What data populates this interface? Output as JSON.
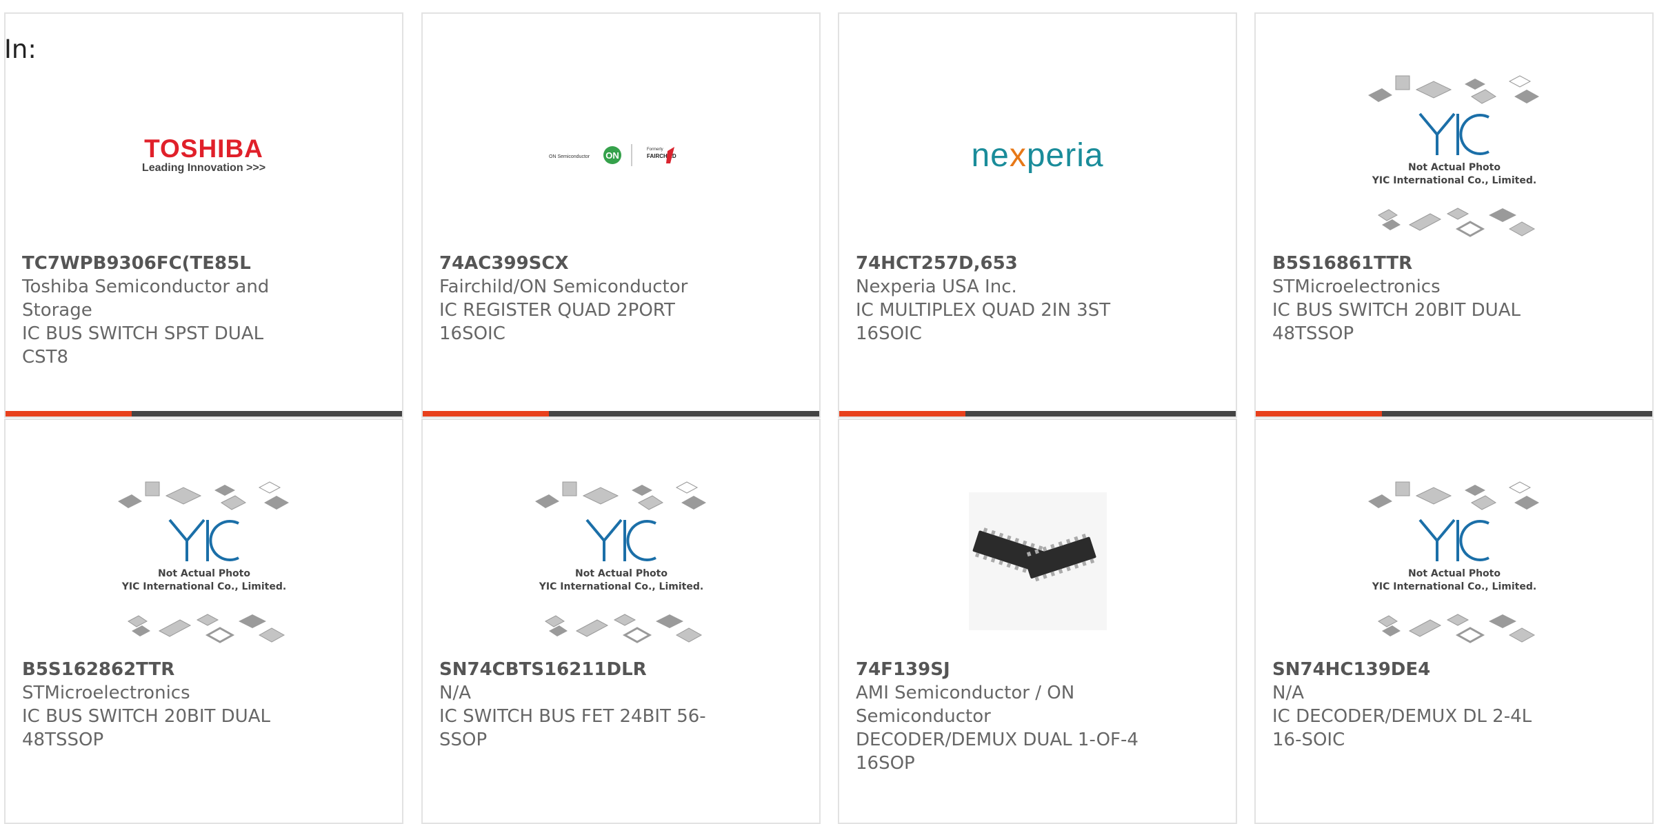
{
  "header": {
    "label": "In:"
  },
  "brand_colors": {
    "accent": "#e8401c",
    "bar": "#444444",
    "toshiba_red": "#e0202a",
    "nexperia_teal": "#1a8c9a",
    "yic_blue": "#1b6fa8"
  },
  "placeholder": {
    "line1": "Not Actual Photo",
    "line2": "YIC International Co., Limited."
  },
  "logos": {
    "toshiba": {
      "brand": "TOSHIBA",
      "tagline": "Leading Innovation >>>"
    },
    "onsemi": {
      "left": "ON Semiconductor",
      "formerly": "Formerly",
      "right": "FAIRCHILD"
    },
    "nexperia": {
      "before": "ne",
      "x": "x",
      "after": "peria"
    }
  },
  "products": [
    {
      "part": "TC7WPB9306FC(TE85L",
      "maker": "Toshiba Semiconductor and Storage",
      "desc": "IC BUS SWITCH SPST DUAL CST8",
      "image": "toshiba-logo"
    },
    {
      "part": "74AC399SCX",
      "maker": "Fairchild/ON Semiconductor",
      "desc": "IC REGISTER QUAD 2PORT 16SOIC",
      "image": "onsemi-fairchild-logo"
    },
    {
      "part": "74HCT257D,653",
      "maker": "Nexperia USA Inc.",
      "desc": "IC MULTIPLEX QUAD 2IN 3ST 16SOIC",
      "image": "nexperia-logo"
    },
    {
      "part": "B5S16861TTR",
      "maker": "STMicroelectronics",
      "desc": "IC BUS SWITCH 20BIT DUAL 48TSSOP",
      "image": "placeholder"
    },
    {
      "part": "B5S162862TTR",
      "maker": "STMicroelectronics",
      "desc": "IC BUS SWITCH 20BIT DUAL 48TSSOP",
      "image": "placeholder"
    },
    {
      "part": "SN74CBTS16211DLR",
      "maker": "N/A",
      "desc": "IC SWITCH BUS FET 24BIT 56-SSOP",
      "image": "placeholder"
    },
    {
      "part": "74F139SJ",
      "maker": "AMI Semiconductor / ON Semiconductor",
      "desc": "DECODER/DEMUX DUAL 1-OF-4 16SOP",
      "image": "chip-photo"
    },
    {
      "part": "SN74HC139DE4",
      "maker": "N/A",
      "desc": "IC DECODER/DEMUX DL 2-4L 16-SOIC",
      "image": "placeholder"
    }
  ]
}
